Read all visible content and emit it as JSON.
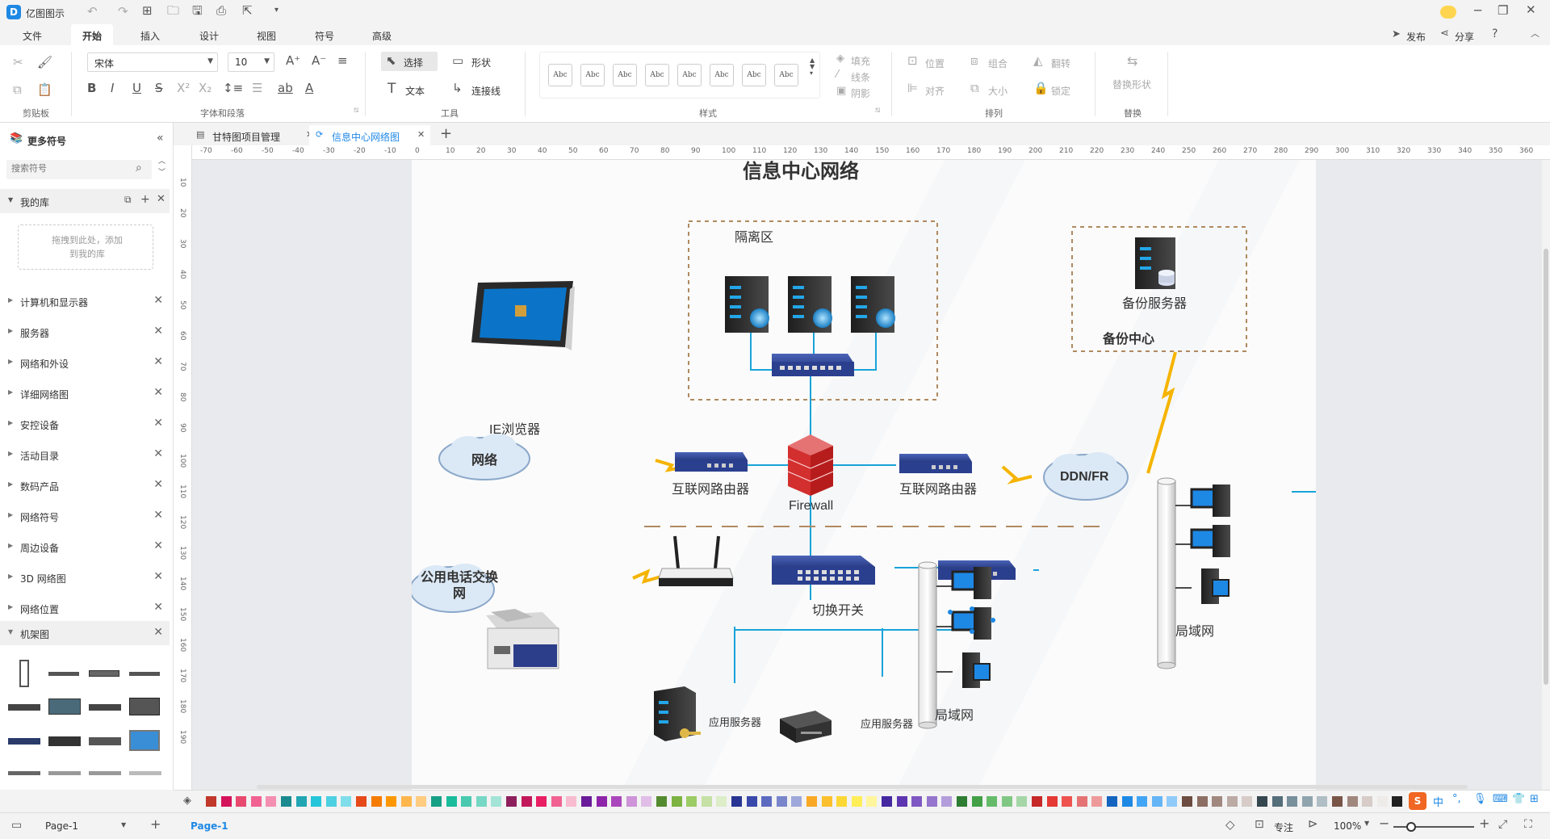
{
  "app": {
    "title": "亿图图示"
  },
  "titlebar": {
    "publish": "发布",
    "share": "分享"
  },
  "menu": {
    "items": [
      "文件",
      "开始",
      "插入",
      "设计",
      "视图",
      "符号",
      "高级"
    ],
    "active": "开始"
  },
  "ribbon": {
    "font_name": "宋体",
    "font_size": "10",
    "select_label": "选择",
    "text_label": "文本",
    "shape_label": "形状",
    "connector_label": "连接线",
    "style_sample": "Abc",
    "fill_label": "填充",
    "line_label": "线条",
    "shadow_label": "阴影",
    "position_label": "位置",
    "group_label": "组合",
    "flip_label": "翻转",
    "align_label": "对齐",
    "size_label": "大小",
    "lock_label": "锁定",
    "replace_shape_label": "替换形状",
    "groups": {
      "clipboard": "剪贴板",
      "font": "字体和段落",
      "tools": "工具",
      "styles": "样式",
      "arrange": "排列",
      "replace": "替换"
    }
  },
  "sidebar": {
    "header": "更多符号",
    "search_placeholder": "搜索符号",
    "my_library": "我的库",
    "my_library_hint": "拖拽到此处，添加到我的库",
    "categories": [
      "计算机和显示器",
      "服务器",
      "网络和外设",
      "详细网络图",
      "安控设备",
      "活动目录",
      "数码产品",
      "网络符号",
      "周边设备",
      "3D 网络图",
      "网络位置",
      "机架图"
    ]
  },
  "tabs": [
    {
      "label": "甘特图项目管理",
      "active": false
    },
    {
      "label": "信息中心网络图",
      "active": true
    }
  ],
  "ruler": {
    "h_ticks": [
      "-70",
      "-60",
      "-50",
      "-40",
      "-30",
      "-20",
      "-10",
      "0",
      "10",
      "20",
      "30",
      "40",
      "50",
      "60",
      "70",
      "80",
      "90",
      "100",
      "110",
      "120",
      "130",
      "140",
      "150",
      "160",
      "170",
      "180",
      "190",
      "200",
      "210",
      "220",
      "230",
      "240",
      "250",
      "260",
      "270",
      "280",
      "290",
      "300",
      "310",
      "320",
      "330",
      "340",
      "350",
      "360"
    ],
    "v_ticks": [
      "10",
      "20",
      "30",
      "40",
      "50",
      "60",
      "70",
      "80",
      "90",
      "100",
      "110",
      "120",
      "130",
      "140",
      "150",
      "160",
      "170",
      "180",
      "190"
    ]
  },
  "diagram": {
    "title": "信息中心网络",
    "isolation_zone": "隔离区",
    "backup_server": "备份服务器",
    "backup_center": "备份中心",
    "ie_browser": "IE浏览器",
    "network_cloud": "网络",
    "router_left": "互联网路由器",
    "router_right": "互联网路由器",
    "firewall": "Firewall",
    "ddn_cloud": "DDN/FR",
    "pstn_cloud": "公用电话交换网",
    "switch": "切换开关",
    "app_server_1": "应用服务器",
    "app_server_2": "应用服务器",
    "lan_1": "局域网",
    "lan_2": "局域网"
  },
  "colorbar": {
    "colors": [
      "#c0392b",
      "#d4145a",
      "#e84a6f",
      "#f06292",
      "#f48fb1",
      "#1b8a8f",
      "#22a6b3",
      "#26c6da",
      "#4dd0e1",
      "#80deea",
      "#e64a19",
      "#f57c00",
      "#ff9800",
      "#ffb74d",
      "#ffcc80",
      "#16a085",
      "#1abc9c",
      "#48c9b0",
      "#76d7c4",
      "#a3e4d7",
      "#8e1f5d",
      "#c2185b",
      "#e91e63",
      "#f06292",
      "#f8bbd0",
      "#6a1b9a",
      "#8e24aa",
      "#ab47bc",
      "#ce93d8",
      "#e1bee7",
      "#558b2f",
      "#7cb342",
      "#9ccc65",
      "#c5e1a5",
      "#dcedc8",
      "#283593",
      "#3949ab",
      "#5c6bc0",
      "#7986cb",
      "#9fa8da",
      "#f9a825",
      "#fbc02d",
      "#fdd835",
      "#ffee58",
      "#fff59d",
      "#4527a0",
      "#5e35b1",
      "#7e57c2",
      "#9575cd",
      "#b39ddb",
      "#2e7d32",
      "#43a047",
      "#66bb6a",
      "#81c784",
      "#a5d6a7",
      "#c62828",
      "#e53935",
      "#ef5350",
      "#e57373",
      "#ef9a9a",
      "#1565c0",
      "#1e88e5",
      "#42a5f5",
      "#64b5f6",
      "#90caf9",
      "#6d4c41",
      "#8d6e63",
      "#a1887f",
      "#bcaaa4",
      "#d7ccc8",
      "#37474f",
      "#546e7a",
      "#78909c",
      "#90a4ae",
      "#b0bec5",
      "#795548",
      "#a1887f",
      "#d7ccc8",
      "#efebe9",
      "#212121"
    ]
  },
  "statusbar": {
    "page_select": "Page-1",
    "page_tab": "Page-1",
    "focus": "专注",
    "zoom": "100%"
  },
  "ime": {
    "label": "中"
  }
}
